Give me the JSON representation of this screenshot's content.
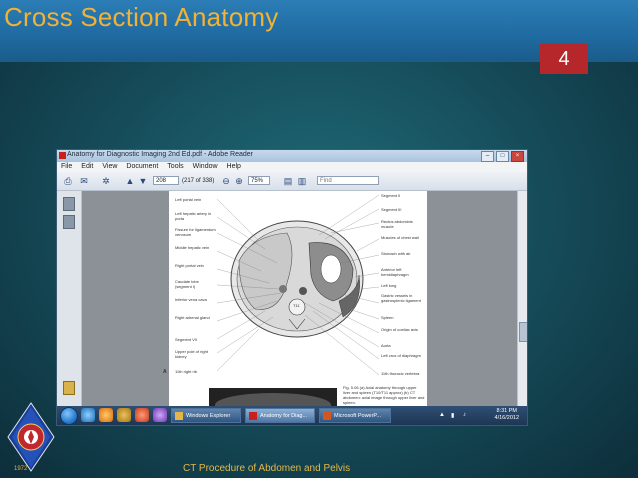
{
  "slide": {
    "title": "Cross Section Anatomy",
    "number": "4",
    "footer": "CT Procedure of Abdomen and Pelvis",
    "logo_year": "1972",
    "colors": {
      "title": "#f2b233",
      "title_bar": "#2c7db6",
      "number_box": "#b5272b"
    }
  },
  "window": {
    "title": "Anatomy for Diagnostic Imaging 2nd Ed.pdf - Adobe Reader",
    "menu": [
      "File",
      "Edit",
      "View",
      "Document",
      "Tools",
      "Window",
      "Help"
    ],
    "toolbar": {
      "page_value": "208",
      "page_count": "(217 of 338)",
      "zoom": "75%",
      "find_placeholder": "Find"
    }
  },
  "figure": {
    "labels_left": [
      "Left portal vein",
      "Left hepatic artery in porta",
      "Fissure for ligamentum venosum",
      "Middle hepatic vein",
      "Right portal vein",
      "Caudate lobe (segment I)",
      "Inferior vena cava",
      "Right adrenal gland",
      "Segment VII",
      "Upper pole of right kidney",
      "11th right rib"
    ],
    "labels_right": [
      "Segment II",
      "Segment III",
      "Rectus abdominis muscle",
      "Muscles of chest wall",
      "Stomach with air",
      "Anterior left hemidiaphragm",
      "Left lung",
      "Gastric vessels in gastrosplenic ligament",
      "Spleen",
      "Origin of coeliac axis",
      "Aorta",
      "Left crus of diaphragm",
      "11th thoracic vertebra"
    ],
    "vertebra_label": "T11",
    "panel_letter": "A",
    "caption": "Fig. 5.06 (a) Axial anatomy through upper liver and spleen (T10/T11 approx) (b) CT abdomen: axial image through upper liver and spleen."
  },
  "taskbar": {
    "apps": [
      "Windows Explorer",
      "Anatomy for Diag...",
      "Microsoft PowerP..."
    ],
    "time": "8:31 PM",
    "date": "4/16/2012"
  }
}
